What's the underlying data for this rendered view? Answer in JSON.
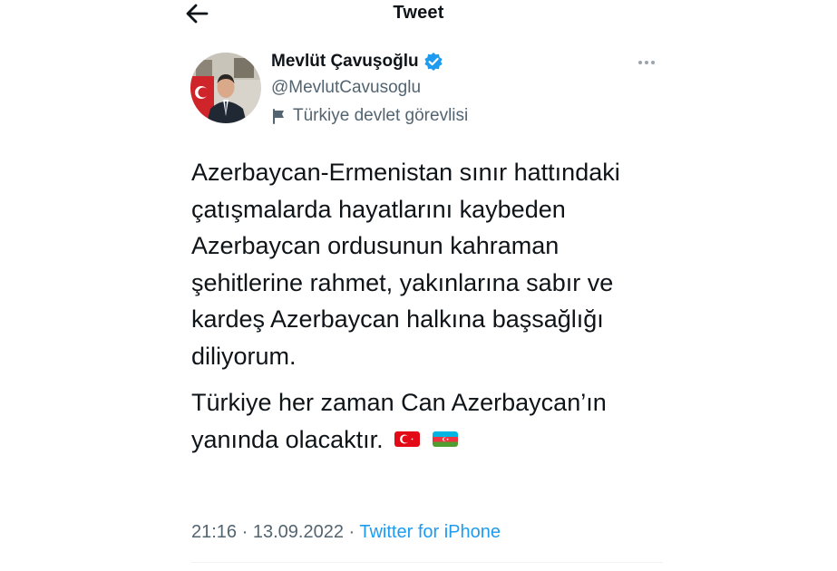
{
  "header": {
    "title": "Tweet"
  },
  "author": {
    "display_name": "Mevlüt Çavuşoğlu",
    "handle": "@MevlutCavusoglu",
    "label": "Türkiye devlet görevlisi"
  },
  "tweet": {
    "paragraph1": "Azerbaycan-Ermenistan sınır hattındaki çatışmalarda hayatlarını kaybeden Azerbaycan ordusunun kahraman şehitlerine rahmet, yakınlarına sabır ve kardeş Azerbaycan halkına başsağlığı diliyorum.",
    "paragraph2": "Türkiye her zaman Can Azerbaycan’ın yanında olacaktır.",
    "emojis": [
      "flag-turkey-icon",
      "flag-azerbaijan-icon"
    ]
  },
  "meta": {
    "time": "21:16",
    "separator": " · ",
    "date": "13.09.2022",
    "separator2": " · ",
    "source": "Twitter for iPhone"
  },
  "colors": {
    "accent": "#1d9bf0",
    "secondary_text": "#536471",
    "primary_text": "#0f1419"
  }
}
